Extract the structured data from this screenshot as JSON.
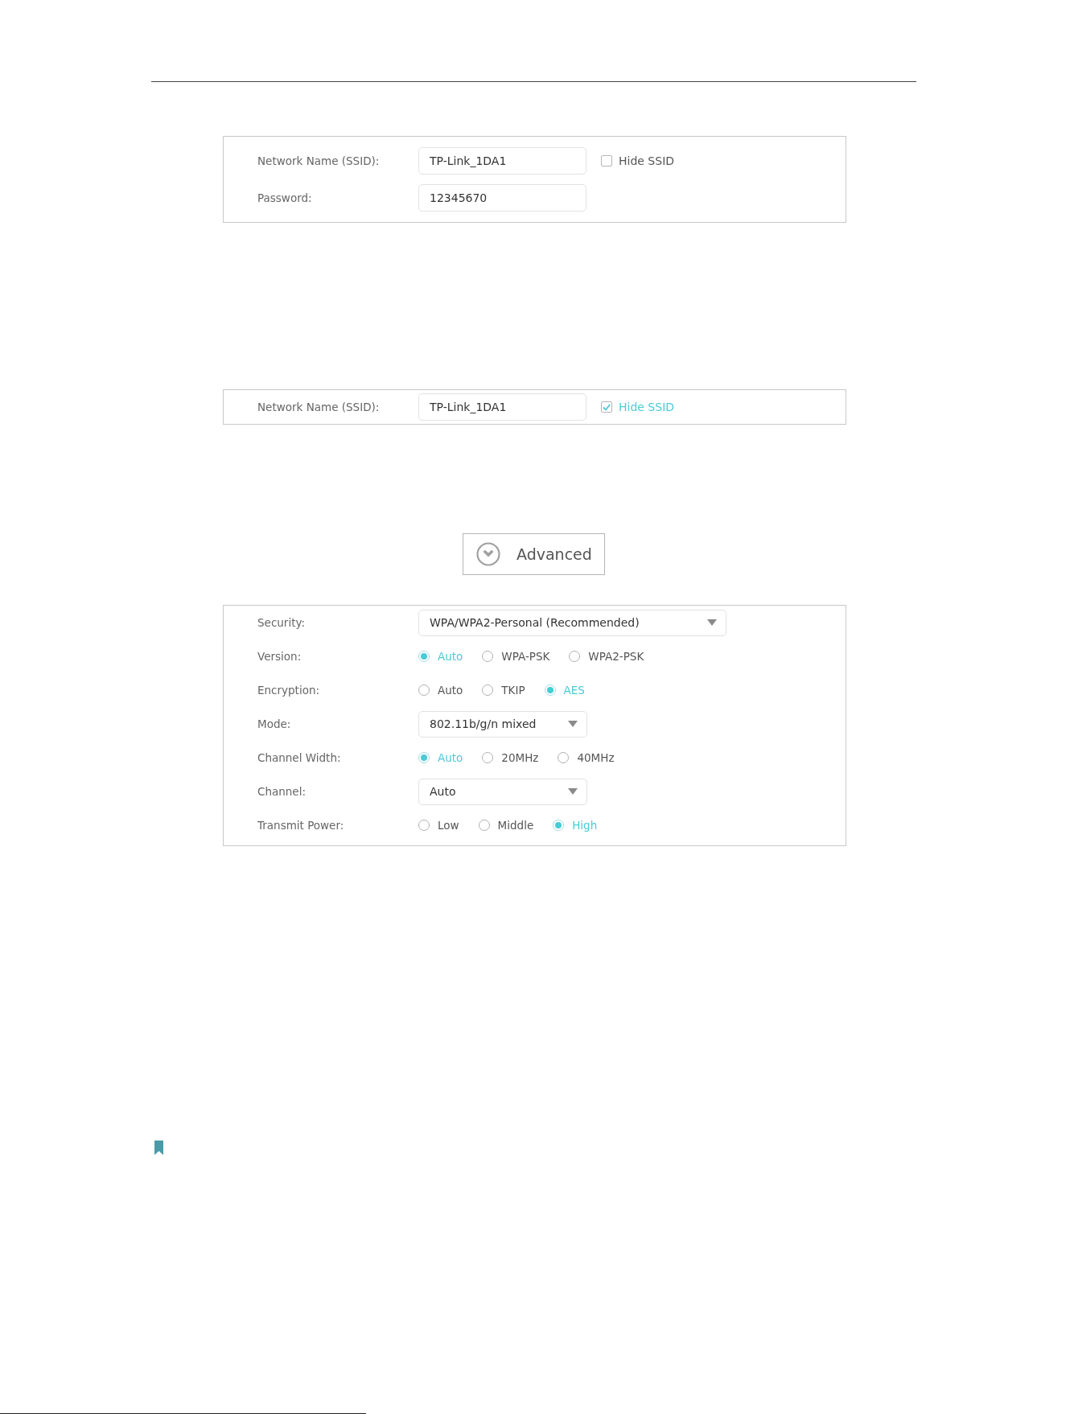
{
  "ssid_panel": {
    "rows": [
      {
        "kind": "text",
        "label": "Network Name (SSID):",
        "value": "TP-Link_1DA1",
        "checkbox": {
          "label": "Hide SSID",
          "checked": false
        }
      },
      {
        "kind": "text",
        "label": "Password:",
        "value": "12345670"
      }
    ]
  },
  "hidden_ssid_panel": {
    "rows": [
      {
        "kind": "text",
        "label": "Network Name (SSID):",
        "value": "TP-Link_1DA1",
        "checkbox": {
          "label": "Hide SSID",
          "checked": true
        }
      }
    ]
  },
  "advanced_button": {
    "label": "Advanced"
  },
  "advanced_panel": {
    "rows": [
      {
        "kind": "select",
        "label": "Security:",
        "value": "WPA/WPA2-Personal (Recommended)"
      },
      {
        "kind": "radio",
        "label": "Version:",
        "options": [
          {
            "label": "Auto",
            "selected": true
          },
          {
            "label": "WPA-PSK",
            "selected": false
          },
          {
            "label": "WPA2-PSK",
            "selected": false
          }
        ]
      },
      {
        "kind": "radio",
        "label": "Encryption:",
        "options": [
          {
            "label": "Auto",
            "selected": false
          },
          {
            "label": "TKIP",
            "selected": false
          },
          {
            "label": "AES",
            "selected": true
          }
        ]
      },
      {
        "kind": "select",
        "label": "Mode:",
        "value": "802.11b/g/n mixed"
      },
      {
        "kind": "radio",
        "label": "Channel Width:",
        "options": [
          {
            "label": "Auto",
            "selected": true
          },
          {
            "label": "20MHz",
            "selected": false
          },
          {
            "label": "40MHz",
            "selected": false
          }
        ]
      },
      {
        "kind": "select",
        "label": "Channel:",
        "value": "Auto"
      },
      {
        "kind": "radio",
        "label": "Transmit Power:",
        "options": [
          {
            "label": "Low",
            "selected": false
          },
          {
            "label": "Middle",
            "selected": false
          },
          {
            "label": "High",
            "selected": true
          }
        ]
      }
    ]
  }
}
